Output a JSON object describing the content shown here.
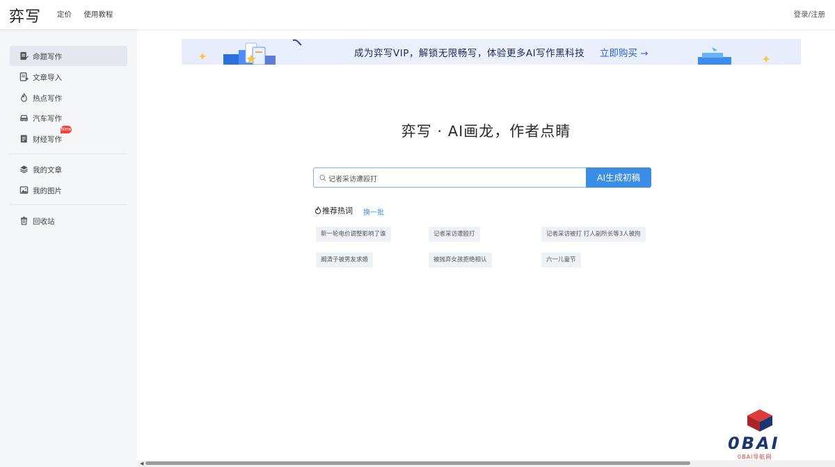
{
  "header": {
    "logo": "弈写",
    "nav": [
      "定价",
      "使用教程"
    ],
    "login": "登录/注册"
  },
  "sidebar": {
    "items": [
      {
        "label": "命题写作",
        "icon": "document-edit-icon",
        "active": true
      },
      {
        "label": "文章导入",
        "icon": "file-import-icon"
      },
      {
        "label": "热点写作",
        "icon": "flame-icon"
      },
      {
        "label": "汽车写作",
        "icon": "car-icon"
      },
      {
        "label": "财经写作",
        "icon": "finance-doc-icon",
        "badge": "New"
      },
      {
        "label": "我的文章",
        "icon": "layers-icon"
      },
      {
        "label": "我的图片",
        "icon": "image-icon"
      },
      {
        "label": "回收站",
        "icon": "trash-icon"
      }
    ]
  },
  "banner": {
    "text": "成为弈写VIP，解锁无限畅写，体验更多AI写作黑科技",
    "cta": "立即购买 →"
  },
  "main": {
    "hero_title": "弈写 · AI画龙，作者点睛",
    "search": {
      "value": "记者采访遭殴打",
      "icon": "search-icon"
    },
    "generate_button": "AI生成初稿",
    "hot": {
      "title": "推荐热词",
      "refresh": "换一批",
      "chips": [
        "新一轮电价调整影响了谁",
        "记者采访遭殴打",
        "记者采访被打 打人副所长等3人被拘",
        "阚清子被男友求婚",
        "被抛弃女孩拒绝相认",
        "六一儿童节"
      ]
    }
  },
  "watermark": {
    "text": "0BAI",
    "sub": "0BAI导航网"
  }
}
